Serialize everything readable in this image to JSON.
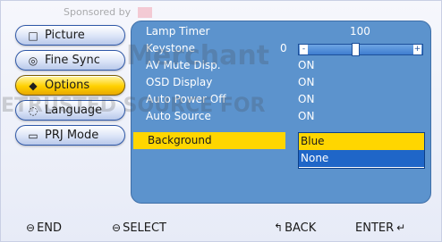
{
  "sponsor_text": "Sponsored by",
  "nav": {
    "items": [
      {
        "label": "Picture",
        "icon": "□"
      },
      {
        "label": "Fine Sync",
        "icon": "◎"
      },
      {
        "label": "Options",
        "icon": "◆"
      },
      {
        "label": "Language",
        "icon": "◌"
      },
      {
        "label": "PRJ Mode",
        "icon": "▭"
      }
    ],
    "active_index": 2
  },
  "panel": {
    "rows": [
      {
        "label": "Lamp Timer",
        "value": "100"
      },
      {
        "label": "Keystone",
        "value": "0"
      },
      {
        "label": "AV Mute Disp.",
        "value": "ON"
      },
      {
        "label": "OSD Display",
        "value": "ON"
      },
      {
        "label": "Auto Power Off",
        "value": "ON"
      },
      {
        "label": "Auto Source",
        "value": "ON"
      },
      {
        "label": "Background",
        "value": "Blue"
      }
    ],
    "keystone_slider": {
      "minus": "-",
      "plus": "+",
      "level_fraction": 0.44
    },
    "dropdown": {
      "selected": "Blue",
      "options": [
        "Blue",
        "None"
      ]
    }
  },
  "watermark": {
    "line1": "Merchant",
    "line2": "ETRUSTED SOURCE FOR"
  },
  "bottom_bar": {
    "end": "END",
    "select": "SELECT",
    "back": "BACK",
    "enter": "ENTER"
  },
  "colors": {
    "panel_bg": "#5c93cd",
    "highlight": "#ffd600",
    "nav_active": "#ffd000",
    "dropdown_other": "#1f66c8"
  }
}
